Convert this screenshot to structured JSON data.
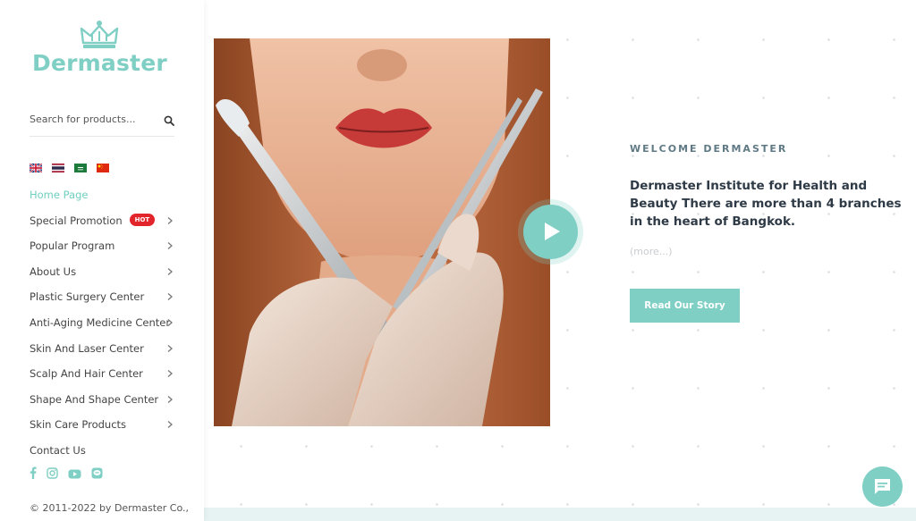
{
  "brand": {
    "name": "Dermaster",
    "color": "#7fcfc4"
  },
  "search": {
    "placeholder": "Search for products..."
  },
  "languages": [
    "en",
    "th",
    "ar",
    "zh"
  ],
  "menu": [
    {
      "label": "Home Page",
      "active": true,
      "chevron": false
    },
    {
      "label": "Special Promotion",
      "badge": "HOT",
      "chevron": true
    },
    {
      "label": "Popular Program",
      "chevron": true
    },
    {
      "label": "About Us",
      "chevron": true
    },
    {
      "label": "Plastic Surgery Center",
      "chevron": true
    },
    {
      "label": "Anti-Aging Medicine Center",
      "chevron": true
    },
    {
      "label": "Skin And Laser Center",
      "chevron": true
    },
    {
      "label": "Scalp And Hair Center",
      "chevron": true
    },
    {
      "label": "Shape And Shape Center",
      "chevron": true
    },
    {
      "label": "Skin Care Products",
      "chevron": true
    },
    {
      "label": "Contact Us",
      "chevron": false
    }
  ],
  "social": [
    "facebook-icon",
    "instagram-icon",
    "youtube-icon",
    "line-icon"
  ],
  "footer": {
    "copyright": "© 2011-2022 by Dermaster Co.,"
  },
  "welcome": {
    "kicker": "WELCOME DERMASTER",
    "headline": "Dermaster Institute for Health and Beauty There are more than 4 branches in the heart of Bangkok.",
    "more": "(more...)",
    "button": "Read Our Story"
  },
  "colors": {
    "accent": "#7fcfc4",
    "hot_badge": "#e2242b",
    "heading": "#2e3a46",
    "kicker": "#607a85"
  }
}
